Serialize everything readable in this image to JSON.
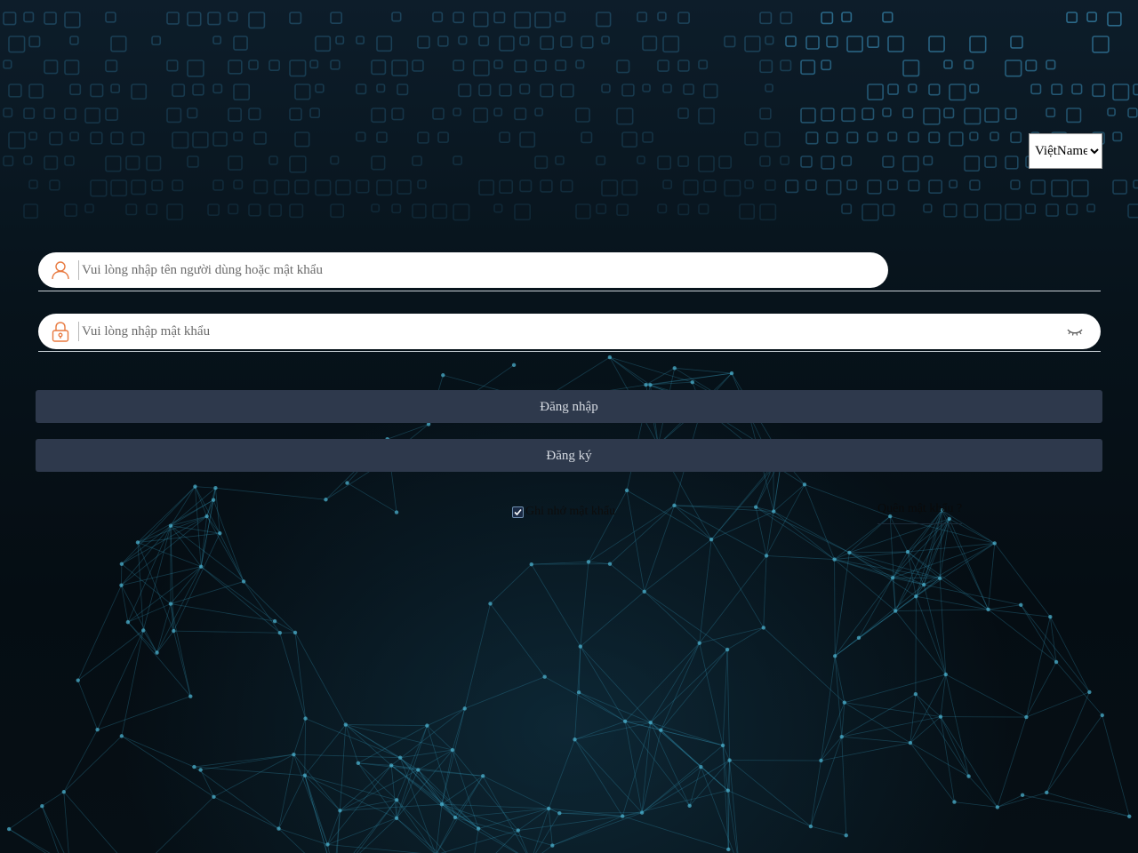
{
  "language": {
    "selected": "ViệtName",
    "options": [
      "ViệtName"
    ]
  },
  "username": {
    "icon": "user-icon",
    "placeholder": "Vui lòng nhập tên người dùng hoặc mật khẩu",
    "value": ""
  },
  "password": {
    "icon": "lock-icon",
    "placeholder": "Vui lòng nhập mật khẩu",
    "value": "",
    "toggle_icon": "eye-closed-icon"
  },
  "buttons": {
    "login": "Đăng nhập",
    "register": "Đăng ký"
  },
  "remember": {
    "label": "Ghi nhớ mật khẩu",
    "checked": true
  },
  "forgot": {
    "label": "Quên mật khẩu ?"
  },
  "colors": {
    "accent_icon": "#e8793f",
    "button_bg": "#2e394c",
    "button_text": "#d6dbe2"
  }
}
